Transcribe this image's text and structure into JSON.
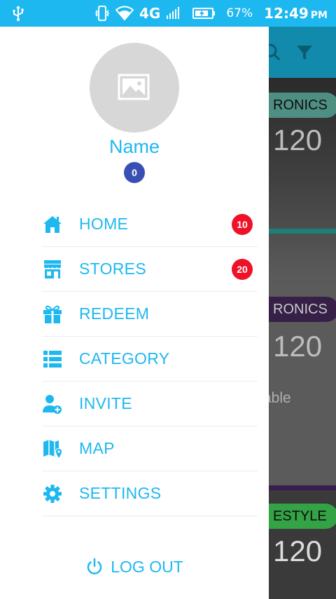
{
  "status_bar": {
    "battery_percent": "67%",
    "network": "4G",
    "time": "12:49",
    "ampm": "PM",
    "icons": [
      "usb-icon",
      "vibrate-icon",
      "wifi-icon",
      "signal-icon",
      "battery-icon"
    ]
  },
  "drawer": {
    "profile": {
      "name": "Name",
      "points": "0",
      "avatar_icon": "image-placeholder-icon"
    },
    "menu": [
      {
        "label": "HOME",
        "icon": "home-icon",
        "badge": "10"
      },
      {
        "label": "STORES",
        "icon": "store-icon",
        "badge": "20"
      },
      {
        "label": "REDEEM",
        "icon": "gift-icon"
      },
      {
        "label": "CATEGORY",
        "icon": "list-icon"
      },
      {
        "label": "INVITE",
        "icon": "add-user-icon"
      },
      {
        "label": "MAP",
        "icon": "map-icon"
      },
      {
        "label": "SETTINGS",
        "icon": "gear-icon"
      }
    ],
    "logout": {
      "label": "LOG OUT",
      "icon": "power-icon"
    }
  },
  "background": {
    "toolbar_icons": [
      "search-icon",
      "filter-icon"
    ],
    "cards": [
      {
        "category": "RONICS",
        "value": "120"
      },
      {
        "category": "RONICS",
        "value": "120",
        "text": "able"
      },
      {
        "category": "ESTYLE",
        "value": "120"
      }
    ]
  },
  "colors": {
    "accent": "#1eb8f0",
    "badge": "#ee1127",
    "points_badge": "#3a4fb4"
  }
}
